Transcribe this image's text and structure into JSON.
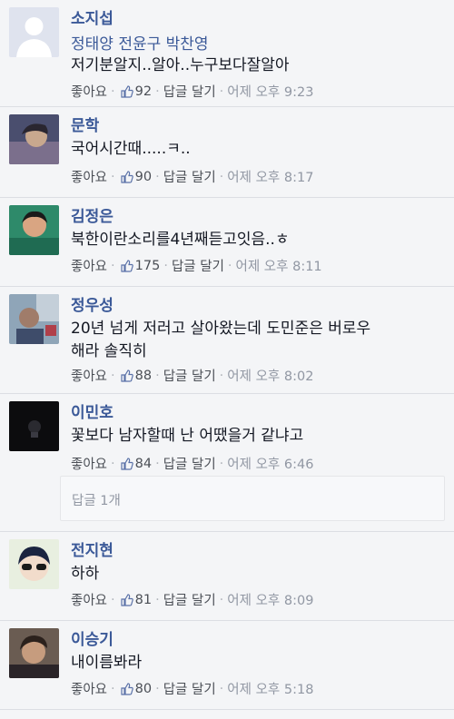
{
  "labels": {
    "like": "좋아요",
    "reply": "답글 달기",
    "sep": "·",
    "reply_count": "답글 1개"
  },
  "comments": [
    {
      "name": "소지섭",
      "tags": "정태양 전윤구 박찬영",
      "text": "저기분알지..알아..누구보다잘알아",
      "likes": "92",
      "time": "어제 오후 9:23"
    },
    {
      "name": "문학",
      "text": "국어시간때.....ㅋ..",
      "likes": "90",
      "time": "어제 오후 8:17"
    },
    {
      "name": "김정은",
      "text": "북한이란소리를4년째듣고잇음..ㅎ",
      "likes": "175",
      "time": "어제 오후 8:11"
    },
    {
      "name": "정우성",
      "text_line1": "20년 넘게 저러고 살아왔는데 도민준은 버로우",
      "text_line2": "해라 솔직히",
      "likes": "88",
      "time": "어제 오후 8:02"
    },
    {
      "name": "이민호",
      "text": "꽃보다 남자할때 난 어땠을거 같냐고",
      "likes": "84",
      "time": "어제 오후 6:46"
    },
    {
      "name": "전지현",
      "text": "하하",
      "likes": "81",
      "time": "어제 오후 8:09"
    },
    {
      "name": "이승기",
      "text": "내이름봐라",
      "likes": "80",
      "time": "어제 오후 5:18"
    }
  ],
  "colors": {
    "name": "#3b5998",
    "text": "#141823",
    "meta": "#4b4f56",
    "time": "#9197a3",
    "background": "#f4f5f7"
  }
}
